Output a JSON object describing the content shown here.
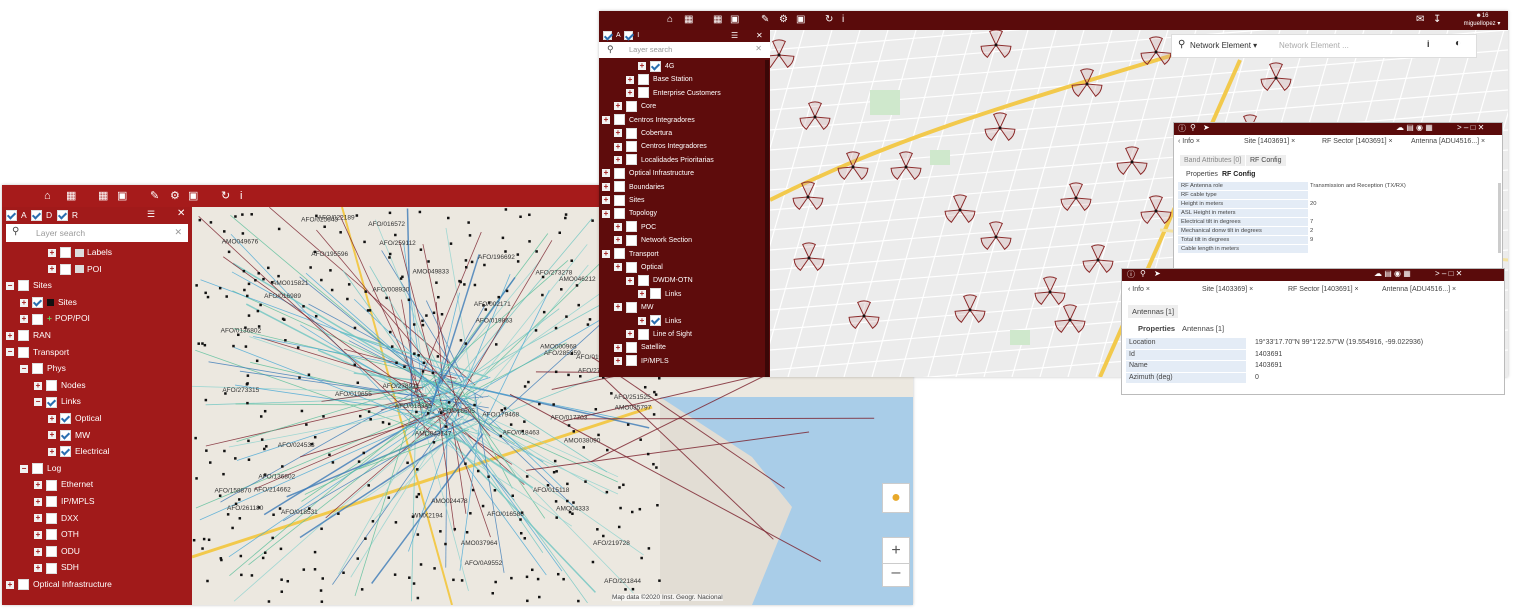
{
  "left_window": {
    "toolbar_icons": [
      "home-icon",
      "table-icon",
      "grid-icon",
      "image-icon",
      "pencil-icon",
      "wrench-icon",
      "camera-icon",
      "refresh-icon",
      "info-icon"
    ],
    "mode_flags": [
      {
        "letter": "A",
        "checked": true
      },
      {
        "letter": "D",
        "checked": true
      },
      {
        "letter": "R",
        "checked": true
      }
    ],
    "search_placeholder": "Layer search",
    "tree": [
      {
        "label": "Labels",
        "depth": 3,
        "checked": false,
        "icon": "label-icon"
      },
      {
        "label": "POI",
        "depth": 3,
        "checked": false,
        "icon": "poi-icon"
      },
      {
        "label": "Sites",
        "depth": 0,
        "checked": false,
        "expanded": true
      },
      {
        "label": "Sites",
        "depth": 1,
        "checked": true,
        "swatch": "#111111"
      },
      {
        "label": "POP/POI",
        "depth": 1,
        "checked": false,
        "marker": "+"
      },
      {
        "label": "RAN",
        "depth": 0,
        "checked": false
      },
      {
        "label": "Transport",
        "depth": 0,
        "checked": false,
        "expanded": true
      },
      {
        "label": "Phys",
        "depth": 1,
        "checked": false,
        "expanded": true
      },
      {
        "label": "Nodes",
        "depth": 2,
        "checked": false
      },
      {
        "label": "Links",
        "depth": 2,
        "checked": true,
        "expanded": true
      },
      {
        "label": "Optical",
        "depth": 3,
        "checked": true
      },
      {
        "label": "MW",
        "depth": 3,
        "checked": true
      },
      {
        "label": "Electrical",
        "depth": 3,
        "checked": true
      },
      {
        "label": "Log",
        "depth": 1,
        "checked": false,
        "expanded": true
      },
      {
        "label": "Ethernet",
        "depth": 2,
        "checked": false
      },
      {
        "label": "IP/MPLS",
        "depth": 2,
        "checked": false
      },
      {
        "label": "DXX",
        "depth": 2,
        "checked": false
      },
      {
        "label": "OTH",
        "depth": 2,
        "checked": false
      },
      {
        "label": "ODU",
        "depth": 2,
        "checked": false
      },
      {
        "label": "SDH",
        "depth": 2,
        "checked": false
      },
      {
        "label": "Optical Infrastructure",
        "depth": 0,
        "checked": false
      }
    ],
    "map_labels": [
      "AFO/0A9552",
      "AFO/024533",
      "AFO/196692",
      "AFO/136802",
      "AMO038090",
      "WMX2194",
      "AFO/278921",
      "AFO/016572",
      "AFO/003452",
      "AFO/017703",
      "AFO/016989",
      "AMO049833",
      "AFO/019863",
      "AFO/018345",
      "AFO/019655",
      "AFO/025643",
      "AFO/002171",
      "AMO000968",
      "AFO/209906",
      "AFO/158870",
      "AFO/195596",
      "AFO/261180",
      "AFO/191324",
      "AMO049676",
      "AFO/251525",
      "AFO/285259",
      "AMO043147",
      "AMO035797",
      "AMO046212",
      "AFO/221844",
      "AFO/008930",
      "AFO/259112",
      "AFO/018463",
      "AMO037964",
      "AFO/273243",
      "AFO/214662",
      "AFO/219728",
      "AFO/016605",
      "AMO024478",
      "AFO/179468",
      "AFO/015118",
      "AFO/022189",
      "AMO015821",
      "AFO/019421",
      "AFO/016588",
      "AFO/273278",
      "AFO/018531",
      "AFO/273315",
      "AMO04333",
      "AFO/0136802"
    ],
    "attribution": "Map data ©2020 Inst. Geogr. Nacional"
  },
  "right_window": {
    "toolbar_icons": [
      "home-icon",
      "table-icon",
      "grid-icon",
      "image-icon",
      "pencil-icon",
      "wrench-icon",
      "camera-icon",
      "refresh-icon",
      "info-icon"
    ],
    "user": {
      "count": "16",
      "name": "miguellopez"
    },
    "mode_flags": [
      {
        "letter": "A",
        "checked": true
      },
      {
        "letter": "I",
        "checked": true
      }
    ],
    "search_placeholder": "Layer search",
    "tree": [
      {
        "label": "4G",
        "depth": 3,
        "checked": true
      },
      {
        "label": "Base Station",
        "depth": 2,
        "checked": false
      },
      {
        "label": "Enterprise Customers",
        "depth": 2,
        "checked": false
      },
      {
        "label": "Core",
        "depth": 1,
        "checked": false
      },
      {
        "label": "Centros Integradores",
        "depth": 0,
        "checked": false
      },
      {
        "label": "Cobertura",
        "depth": 1,
        "checked": false
      },
      {
        "label": "Centros Integradores",
        "depth": 1,
        "checked": false
      },
      {
        "label": "Localidades Prioritarias",
        "depth": 1,
        "checked": false
      },
      {
        "label": "Optical Infrastructure",
        "depth": 0,
        "checked": false
      },
      {
        "label": "Boundaries",
        "depth": 0,
        "checked": false
      },
      {
        "label": "Sites",
        "depth": 0,
        "checked": false
      },
      {
        "label": "Topology",
        "depth": 0,
        "checked": false
      },
      {
        "label": "POC",
        "depth": 1,
        "checked": false
      },
      {
        "label": "Network Section",
        "depth": 1,
        "checked": false
      },
      {
        "label": "Transport",
        "depth": 0,
        "checked": false
      },
      {
        "label": "Optical",
        "depth": 1,
        "checked": false
      },
      {
        "label": "DWDM-OTN",
        "depth": 2,
        "checked": false
      },
      {
        "label": "Links",
        "depth": 3,
        "checked": false
      },
      {
        "label": "MW",
        "depth": 1,
        "checked": false
      },
      {
        "label": "Links",
        "depth": 3,
        "checked": true
      },
      {
        "label": "Line of Sight",
        "depth": 2,
        "checked": false
      },
      {
        "label": "Satellite",
        "depth": 1,
        "checked": false
      },
      {
        "label": "IP/MPLS",
        "depth": 1,
        "checked": false
      }
    ],
    "ne_search": {
      "type": "Network Element",
      "placeholder": "Network Element ..."
    },
    "popup1": {
      "tabs": [
        "Info",
        "Site [1403691]",
        "RF Sector [1403691]",
        "Antenna [ADU4516...]"
      ],
      "subtabs": [
        "Band Attributes [0]",
        "RF Config"
      ],
      "inner_tabs": [
        "Properties",
        "RF Config"
      ],
      "rows": [
        {
          "label": "RF Antenna role",
          "value": "Transmission and Reception (TX/RX)"
        },
        {
          "label": "RF cable type",
          "value": ""
        },
        {
          "label": "Height in meters",
          "value": "20"
        },
        {
          "label": "ASL Height in meters",
          "value": ""
        },
        {
          "label": "Electrical tilt in degrees",
          "value": "7"
        },
        {
          "label": "Mechanical donw tilt in degrees",
          "value": "2"
        },
        {
          "label": "Total tilt in degrees",
          "value": "9"
        },
        {
          "label": "Cable length in meters",
          "value": ""
        }
      ]
    },
    "popup2": {
      "tabs": [
        "Info",
        "Site [1403369]",
        "RF Sector [1403691]",
        "Antenna [ADU4516...]"
      ],
      "subtab": "Antennas [1]",
      "inner_tabs": [
        "Properties",
        "Antennas [1]"
      ],
      "rows": [
        {
          "label": "Location",
          "value": "19°33'17.70\"N 99°1'22.57\"W (19.554916, -99.022936)"
        },
        {
          "label": "Id",
          "value": "1403691"
        },
        {
          "label": "Name",
          "value": "1403691"
        },
        {
          "label": "Azimuth (deg)",
          "value": "0"
        }
      ]
    },
    "colors": {
      "toolbar": "#5a0b0b",
      "panel": "#5e0c0c",
      "left_panel": "#a11a1a",
      "sector": "#8b2a2a"
    }
  }
}
